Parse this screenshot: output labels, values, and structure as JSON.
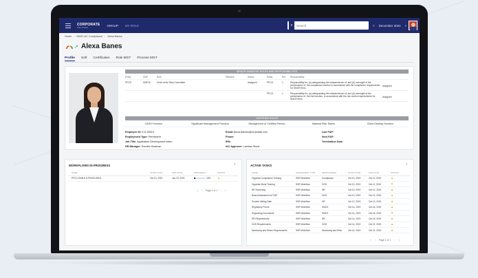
{
  "topbar": {
    "logo": "CORPORATE",
    "logo_sub": "SOLUTIONS",
    "nav": [
      "GROUP",
      "MY ROLE"
    ],
    "search_placeholder": "Search",
    "prev": "<",
    "date": "December 2024",
    "next": ">"
  },
  "breadcrumb": [
    "Home",
    "NWS UIC Compliance",
    "Alexa Banes"
  ],
  "profile": {
    "name": "Alexa Banes",
    "tabs": [
      "Profile",
      "Soft",
      "Certificates",
      "Role MGT",
      "Process MGT"
    ],
    "active_tab": "Profile"
  },
  "senior_manager": {
    "title": "SENIOR MANAGER ROLES AND RESPONSIBILITIES",
    "columns": [
      "Entity",
      "SMF",
      "Role",
      "Effective",
      "Status",
      "Entity",
      "Ref",
      "Responsibility",
      ""
    ],
    "rows": [
      [
        "PFCO",
        "SMF16",
        "Chair of the Risk Committee",
        "",
        "Assigned",
        "PFCO",
        "1",
        "Responsibility for: (a) safeguarding the independence of; and (b) oversight of the performance of, the compliance function in accordance with the compliance requirements for SMCR firms.",
        ""
      ],
      [
        "",
        "",
        "",
        "",
        "",
        "PFCO",
        "1",
        "Responsibility for: (a) safeguarding the independence of; and (b) oversight of the performance of, the risk function, in accordance with the risk control requirements for SMCR firms.",
        "Assigned"
      ]
    ],
    "first_row_extra": "Assigned"
  },
  "certified": {
    "title": "CERTIFIED ROLES",
    "roles": [
      "CASS Function",
      "Significant Management Function",
      "Management of Certified Person",
      "Material Risk Takers",
      "Client Dealing Function"
    ]
  },
  "details": [
    {
      "label": "Employee ID:",
      "value": "E-E-00013"
    },
    {
      "label": "Email:",
      "value": "Alexa.Barnes@corporate.com"
    },
    {
      "label": "Last F&P:",
      "value": ""
    },
    {
      "label": "Employment Type:",
      "value": "Permanent"
    },
    {
      "label": "Phone:",
      "value": ""
    },
    {
      "label": "Next F&P:",
      "value": ""
    },
    {
      "label": "Job Title:",
      "value": "Application Development Intern"
    },
    {
      "label": "IRN:",
      "value": ""
    },
    {
      "label": "Termination Date:",
      "value": ""
    },
    {
      "label": "HR Manager:",
      "value": "Dominic Bowman"
    },
    {
      "label": "IAC Approver:",
      "value": "Lachlan Stone"
    },
    {
      "label": "",
      "value": ""
    }
  ],
  "workflows": {
    "title": "WORKFLOWS IN PROGRESS",
    "columns": [
      "NAME",
      "START DATE",
      "END DATE",
      "PROGRESS",
      "STATUS"
    ],
    "rows": [
      {
        "name": "PFCO-ONB-E-E-P0029-15574",
        "start": "Oct 10, 2019",
        "end": "Jan 19, 2020",
        "progress": 0.15,
        "progress_label": "15%"
      }
    ],
    "pager": {
      "label": "Page 1 of 1"
    }
  },
  "active_tasks": {
    "title": "ACTIVE TASKS",
    "columns": [
      "NAME",
      "ASSIGNMENT TYPE",
      "RESPONSIBLE",
      "START DATE",
      "DUE DATE",
      "STATUS"
    ],
    "rows": [
      [
        "Organise Compliance Training",
        "SHR Workflow",
        "Compliance",
        "Oct 10, 2019",
        "Oct 11, 2019"
      ],
      [
        "Organise Bond Training",
        "SHR Workflow",
        "GGS",
        "Oct 10, 2019",
        "Oct 11, 2019"
      ],
      [
        "HR Screening",
        "SHR Workflow",
        "HR",
        "Oct 10, 2019",
        "Oct 12, 2019"
      ],
      [
        "Board Assessment of F&P",
        "SHR Workflow",
        "GGS",
        "Oct 10, 2019",
        "Oct 12, 2019"
      ],
      [
        "Provide Vetting Date",
        "SHR Workflow",
        "HR",
        "Oct 10, 2019",
        "Oct 13, 2019"
      ],
      [
        "Regulatory Forms",
        "SHR Workflow",
        "SMCS",
        "Oct 14, 2019",
        "Oct 18, 2019"
      ],
      [
        "Supporting Documents",
        "SHR Workflow",
        "SMCS",
        "Oct 14, 2019",
        "Oct 18, 2019"
      ],
      [
        "HR Requirements",
        "SHR Workflow",
        "HR",
        "Oct 14, 2019",
        "Oct 18, 2019"
      ],
      [
        "GGS Requirements",
        "SHR Workflow",
        "GGS",
        "Oct 14, 2019",
        "Oct 21, 2019"
      ],
      [
        "Monitoring and Ethics Requirements",
        "SHR Workflow",
        "Monitoring and Ethic",
        "Oct 14, 2019",
        "Oct 21, 2019"
      ]
    ],
    "pager": {
      "label": "Page 1 of 1"
    }
  },
  "colors": {
    "navy": "#1f2a6b",
    "warning": "#e7a51a",
    "header_grey": "#9a9da3"
  },
  "icons": {
    "menu": "menu-icon",
    "search": "search-icon",
    "warning": "warning-icon",
    "gauge": "gauge-icon",
    "trend": "trend-arrow-icon"
  }
}
